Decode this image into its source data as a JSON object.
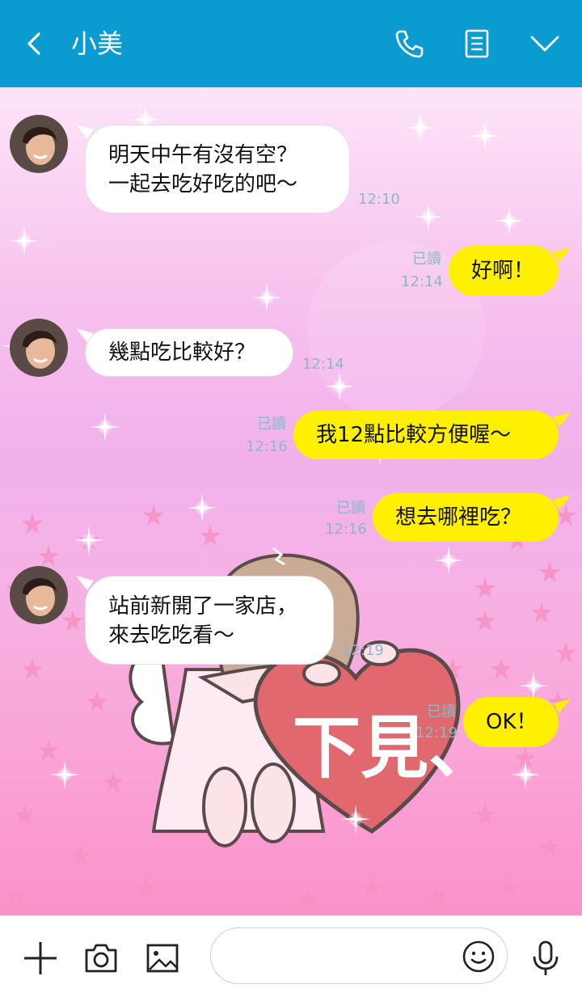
{
  "header": {
    "contact_name": "小美",
    "icons": [
      "back-icon",
      "phone-icon",
      "notes-icon",
      "chevron-down-icon"
    ]
  },
  "messages": [
    {
      "side": "in",
      "lines": [
        "明天中午有沒有空？",
        "一起去吃好吃的吧～"
      ],
      "time": "12:10"
    },
    {
      "side": "out",
      "lines": [
        "好啊！"
      ],
      "read": "已讀",
      "time": "12:14"
    },
    {
      "side": "in",
      "lines": [
        "幾點吃比較好？"
      ],
      "time": "12:14"
    },
    {
      "side": "out",
      "lines": [
        "我12點比較方便喔～"
      ],
      "read": "已讀",
      "time": "12:16"
    },
    {
      "side": "out",
      "lines": [
        "想去哪裡吃？"
      ],
      "read": "已讀",
      "time": "12:16"
    },
    {
      "side": "in",
      "lines": [
        "站前新開了一家店，",
        "來去吃吃看～"
      ],
      "time": "12:19"
    },
    {
      "side": "out",
      "lines": [
        "OK！"
      ],
      "read": "已讀",
      "time": "12:19"
    }
  ],
  "theme_art": {
    "heart_text": "下見、",
    "colors": {
      "heart": "#e0686e",
      "heart_outline": "#5a4a4a",
      "hair": "#c9ab96",
      "dress": "#fdeaf3"
    }
  },
  "colors": {
    "header": "#0a9bd0",
    "bubble_in": "#ffffff",
    "bubble_out": "#fff000",
    "meta_text": "#8cb8c8"
  },
  "input_bar": {
    "placeholder": "",
    "icons": [
      "plus-icon",
      "camera-icon",
      "image-icon",
      "emoji-icon",
      "microphone-icon"
    ]
  }
}
